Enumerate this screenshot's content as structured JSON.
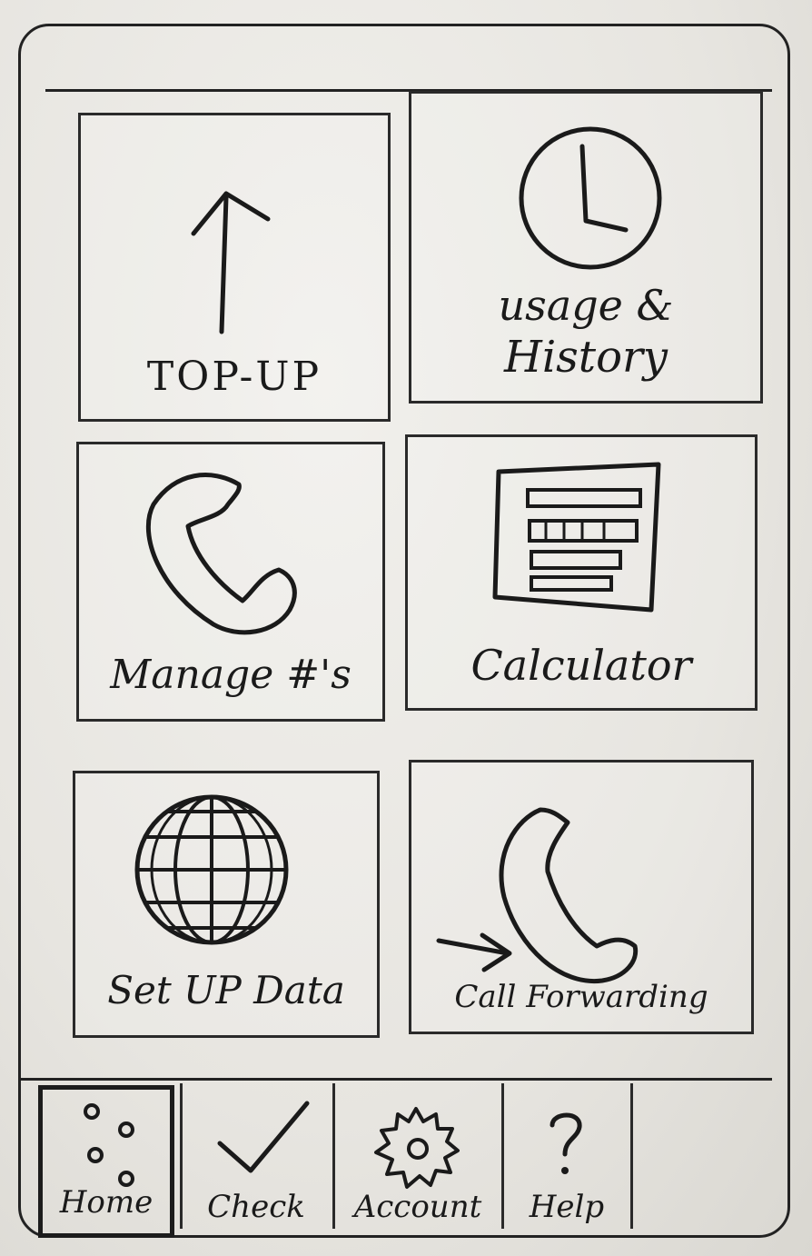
{
  "tiles": [
    {
      "id": "top-up",
      "label": "TOP-UP",
      "icon": "arrow-up-icon"
    },
    {
      "id": "usage-history",
      "label_line1": "usage &",
      "label_line2": "History",
      "icon": "clock-icon"
    },
    {
      "id": "manage",
      "label": "Manage #'s",
      "icon": "phone-icon"
    },
    {
      "id": "calculator",
      "label": "Calculator",
      "icon": "calculator-icon"
    },
    {
      "id": "set-up-data",
      "label": "Set UP Data",
      "icon": "globe-icon"
    },
    {
      "id": "call-forwarding",
      "label": "Call Forwarding",
      "icon": "forward-call-icon"
    }
  ],
  "nav": [
    {
      "id": "home",
      "label": "Home",
      "icon": "dots-icon",
      "active": true
    },
    {
      "id": "check",
      "label": "Check",
      "icon": "check-icon",
      "active": false
    },
    {
      "id": "account",
      "label": "Account",
      "icon": "gear-icon",
      "active": false
    },
    {
      "id": "help",
      "label": "Help",
      "icon": "question-icon",
      "active": false
    }
  ]
}
